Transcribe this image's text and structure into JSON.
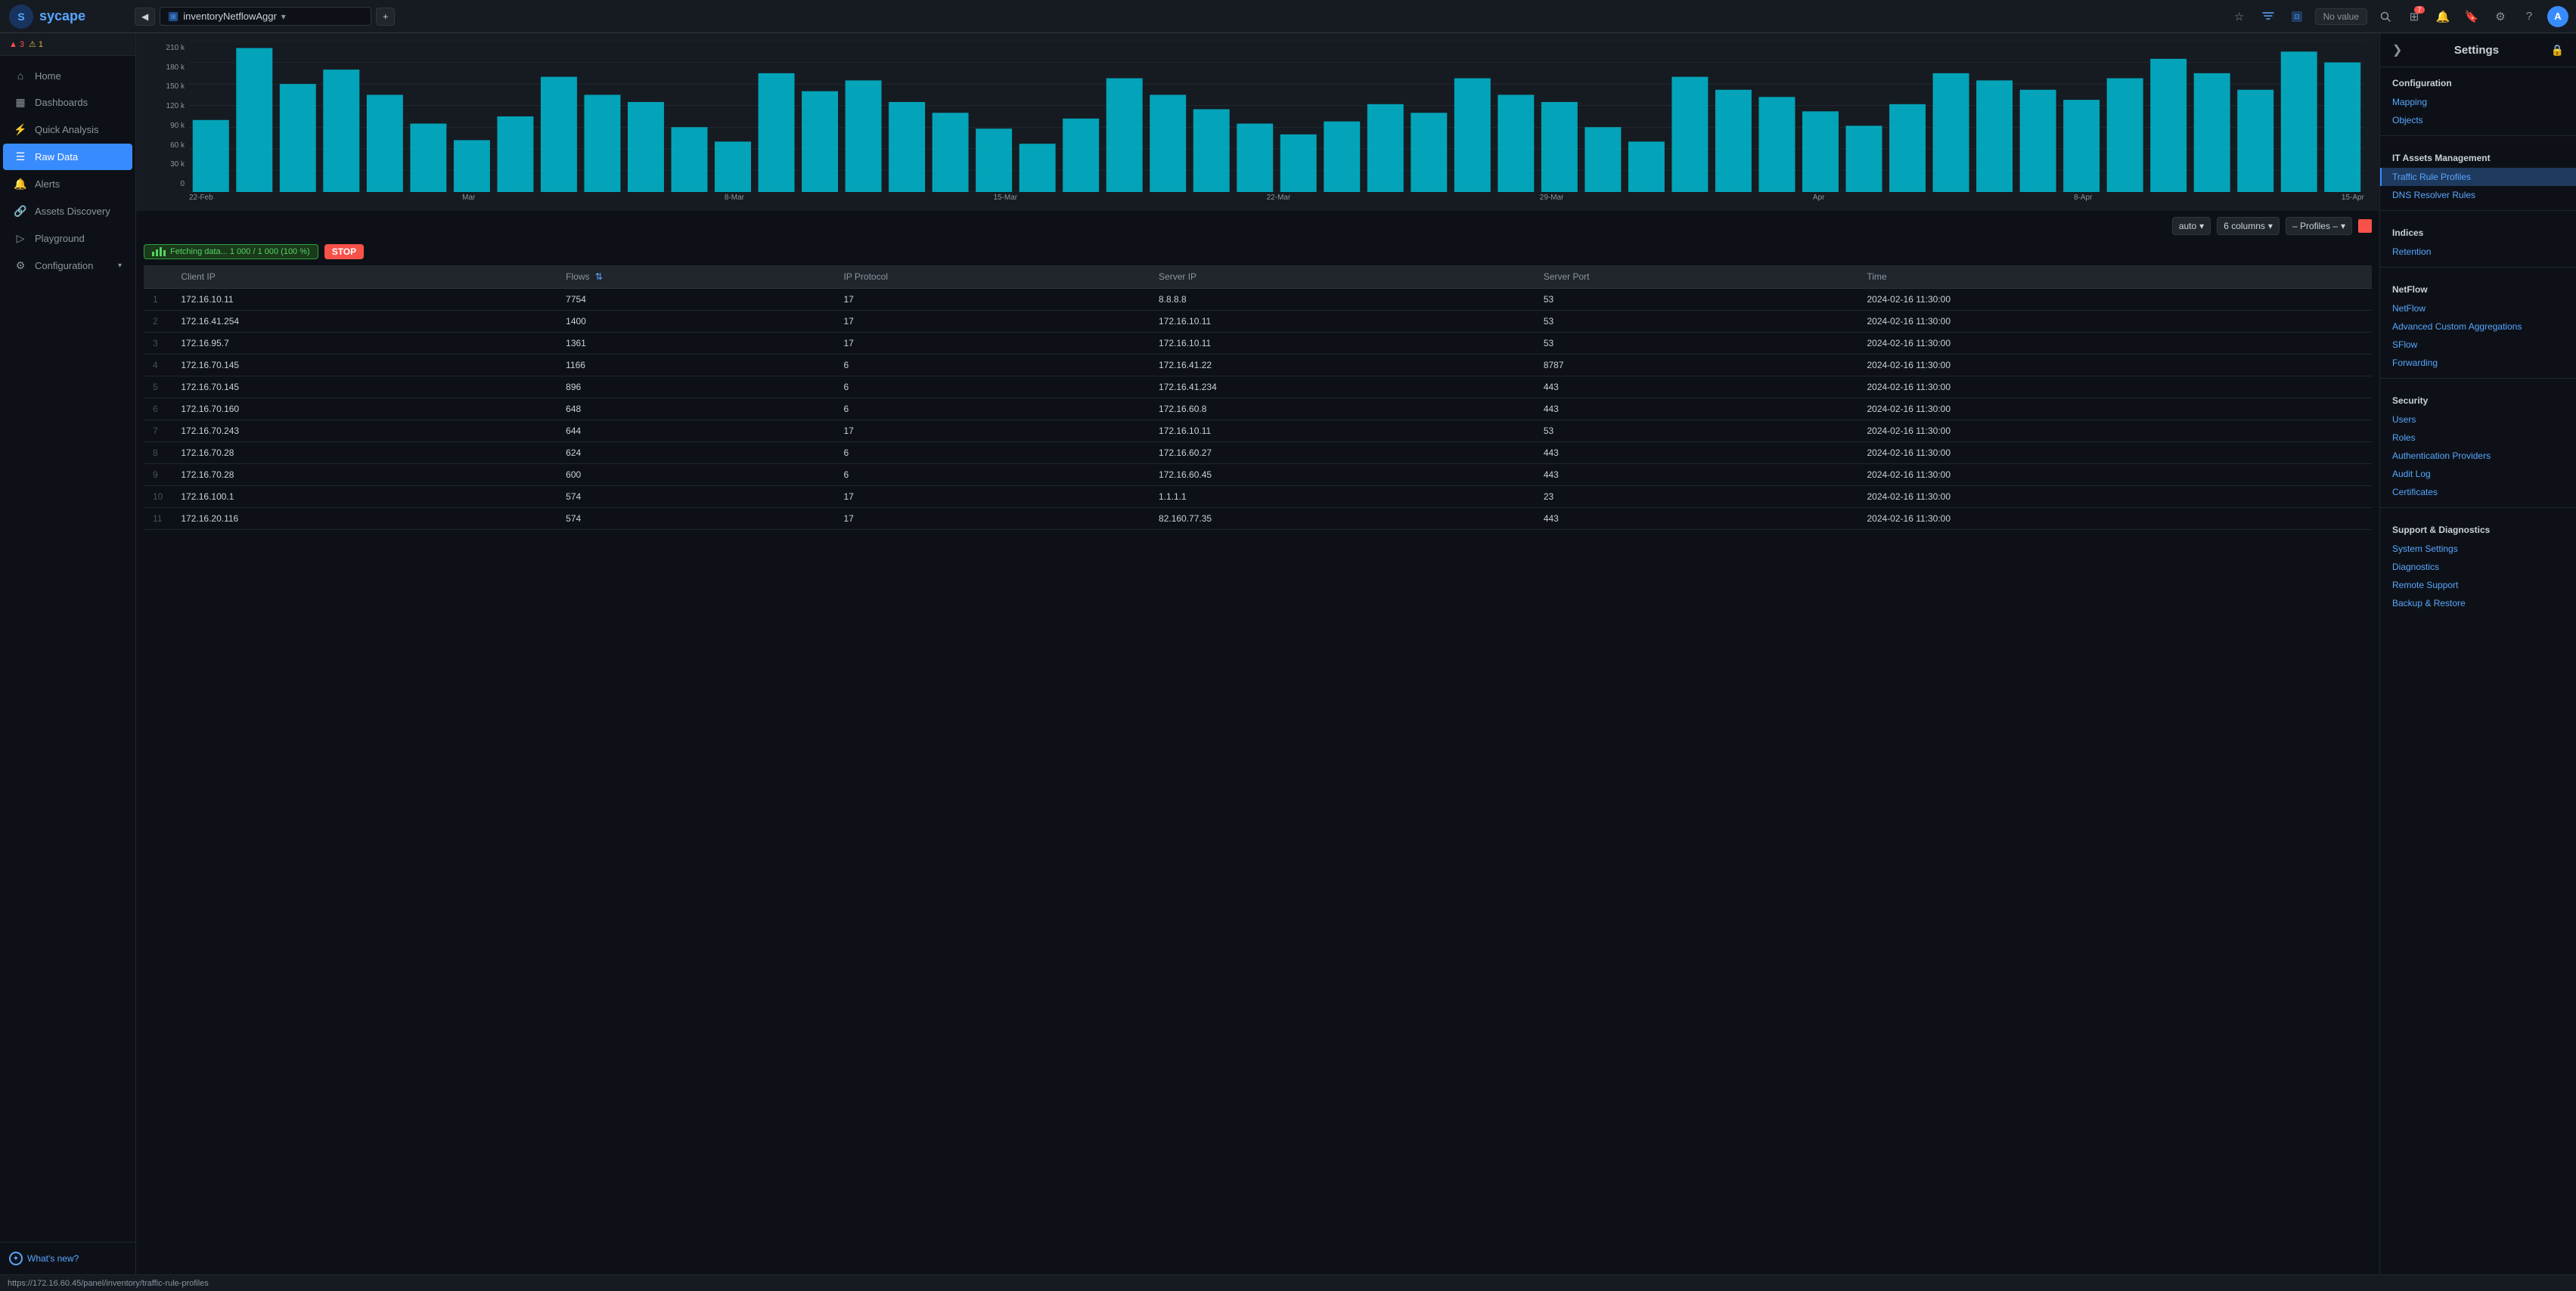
{
  "topbar": {
    "logo_text": "sycape",
    "nav_back_label": "◀",
    "query_label": "inventoryNetflowAggr",
    "dropdown_icon": "▾",
    "plus_icon": "+",
    "novalue_label": "No value",
    "search_icon": "🔍",
    "grid_icon": "⊞",
    "bell_icon": "🔔",
    "bell_badge": "7",
    "bookmark_icon": "🔖",
    "gear_icon": "⚙",
    "help_icon": "?",
    "avatar_label": "A"
  },
  "sidebar": {
    "alerts": {
      "red_icon": "▲",
      "red_count": "3",
      "yellow_icon": "⚠",
      "yellow_count": "1"
    },
    "items": [
      {
        "id": "home",
        "label": "Home",
        "icon": "⌂"
      },
      {
        "id": "dashboards",
        "label": "Dashboards",
        "icon": "▦"
      },
      {
        "id": "quick-analysis",
        "label": "Quick Analysis",
        "icon": "⚡"
      },
      {
        "id": "raw-data",
        "label": "Raw Data",
        "icon": "☰",
        "active": true
      },
      {
        "id": "alerts",
        "label": "Alerts",
        "icon": "🔔"
      },
      {
        "id": "assets-discovery",
        "label": "Assets Discovery",
        "icon": "🔗"
      },
      {
        "id": "playground",
        "label": "Playground",
        "icon": "▷"
      },
      {
        "id": "configuration",
        "label": "Configuration",
        "icon": "⚙",
        "has_arrow": true
      }
    ],
    "footer": {
      "whats_new_label": "What's new?"
    }
  },
  "chart": {
    "y_labels": [
      "210 k",
      "180 k",
      "150 k",
      "120 k",
      "90 k",
      "60 k",
      "30 k",
      "0"
    ],
    "x_labels": [
      "22-Feb",
      "Mar",
      "8-Mar",
      "15-Mar",
      "22-Mar",
      "29-Mar",
      "Apr",
      "8-Apr",
      "15-Apr"
    ],
    "bars": [
      100,
      190,
      140,
      160,
      130,
      90,
      70,
      110,
      160,
      130,
      120,
      80,
      75,
      170,
      135,
      150,
      120,
      105,
      80,
      65,
      100,
      155,
      130,
      110,
      90,
      80,
      95,
      120,
      110,
      160,
      130,
      120,
      90,
      70,
      155,
      140,
      130,
      110,
      90,
      120,
      170,
      155,
      140,
      125,
      160,
      185,
      165,
      140,
      195,
      180
    ]
  },
  "table_controls": {
    "auto_label": "auto",
    "columns_label": "6 columns",
    "profiles_label": "– Profiles –",
    "dropdown_icon": "▾"
  },
  "fetch_bar": {
    "status_label": "Fetching data... 1 000 / 1 000 (100 %)",
    "stop_label": "STOP"
  },
  "table": {
    "columns": [
      "",
      "Client IP",
      "Flows",
      "",
      "IP Protocol",
      "Server IP",
      "Server Port",
      "Time"
    ],
    "rows": [
      {
        "num": "",
        "client_ip": "172.16.10.11",
        "flows": "7754",
        "proto": "17",
        "server_ip": "8.8.8.8",
        "server_port": "53",
        "time": "2024-02-16 11:30:00"
      },
      {
        "num": "",
        "client_ip": "172.16.41.254",
        "flows": "1400",
        "proto": "17",
        "server_ip": "172.16.10.11",
        "server_port": "53",
        "time": "2024-02-16 11:30:00"
      },
      {
        "num": "",
        "client_ip": "172.16.95.7",
        "flows": "1361",
        "proto": "17",
        "server_ip": "172.16.10.11",
        "server_port": "53",
        "time": "2024-02-16 11:30:00"
      },
      {
        "num": "",
        "client_ip": "172.16.70.145",
        "flows": "1166",
        "proto": "6",
        "server_ip": "172.16.41.22",
        "server_port": "8787",
        "time": "2024-02-16 11:30:00"
      },
      {
        "num": "",
        "client_ip": "172.16.70.145",
        "flows": "896",
        "proto": "6",
        "server_ip": "172.16.41.234",
        "server_port": "443",
        "time": "2024-02-16 11:30:00"
      },
      {
        "num": "",
        "client_ip": "172.16.70.160",
        "flows": "648",
        "proto": "6",
        "server_ip": "172.16.60.8",
        "server_port": "443",
        "time": "2024-02-16 11:30:00"
      },
      {
        "num": "",
        "client_ip": "172.16.70.243",
        "flows": "644",
        "proto": "17",
        "server_ip": "172.16.10.11",
        "server_port": "53",
        "time": "2024-02-16 11:30:00"
      },
      {
        "num": "",
        "client_ip": "172.16.70.28",
        "flows": "624",
        "proto": "6",
        "server_ip": "172.16.60.27",
        "server_port": "443",
        "time": "2024-02-16 11:30:00"
      },
      {
        "num": "",
        "client_ip": "172.16.70.28",
        "flows": "600",
        "proto": "6",
        "server_ip": "172.16.60.45",
        "server_port": "443",
        "time": "2024-02-16 11:30:00"
      },
      {
        "num": "",
        "client_ip": "172.16.100.1",
        "flows": "574",
        "proto": "17",
        "server_ip": "1.1.1.1",
        "server_port": "23",
        "time": "2024-02-16 11:30:00"
      },
      {
        "num": "",
        "client_ip": "172.16.20.116",
        "flows": "574",
        "proto": "17",
        "server_ip": "82.160.77.35",
        "server_port": "443",
        "time": "2024-02-16 11:30:00"
      }
    ]
  },
  "right_panel": {
    "toggle_icon": "❯",
    "title": "Settings",
    "lock_icon": "🔒",
    "sections": [
      {
        "id": "configuration",
        "header": "Configuration",
        "links": [
          {
            "id": "mapping",
            "label": "Mapping"
          },
          {
            "id": "objects",
            "label": "Objects"
          }
        ]
      },
      {
        "id": "it-assets-management",
        "header": "IT Assets Management",
        "links": [
          {
            "id": "traffic-rule-profiles",
            "label": "Traffic Rule Profiles",
            "active": true
          },
          {
            "id": "dns-resolver-rules",
            "label": "DNS Resolver Rules"
          }
        ]
      },
      {
        "id": "indices",
        "header": "Indices",
        "links": [
          {
            "id": "retention",
            "label": "Retention"
          }
        ]
      },
      {
        "id": "netflow",
        "header": "NetFlow",
        "links": [
          {
            "id": "netflow",
            "label": "NetFlow"
          },
          {
            "id": "advanced-custom-aggregations",
            "label": "Advanced Custom Aggregations"
          },
          {
            "id": "sflow",
            "label": "SFlow"
          },
          {
            "id": "forwarding",
            "label": "Forwarding"
          }
        ]
      },
      {
        "id": "security",
        "header": "Security",
        "links": [
          {
            "id": "users",
            "label": "Users"
          },
          {
            "id": "roles",
            "label": "Roles"
          },
          {
            "id": "authentication-providers",
            "label": "Authentication Providers"
          },
          {
            "id": "audit-log",
            "label": "Audit Log"
          },
          {
            "id": "certificates",
            "label": "Certificates"
          }
        ]
      },
      {
        "id": "support-diagnostics",
        "header": "Support & Diagnostics",
        "links": [
          {
            "id": "system-settings",
            "label": "System Settings"
          },
          {
            "id": "diagnostics",
            "label": "Diagnostics"
          },
          {
            "id": "remote-support",
            "label": "Remote Support"
          },
          {
            "id": "backup-restore",
            "label": "Backup & Restore"
          }
        ]
      }
    ]
  },
  "statusbar": {
    "url": "https://172.16.60.45/panel/inventory/traffic-rule-profiles"
  }
}
